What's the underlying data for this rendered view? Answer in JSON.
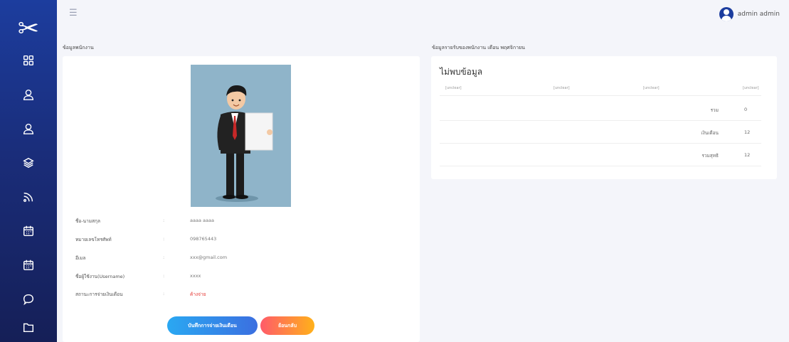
{
  "sidebar": {
    "logo_icon": "scissors-icon",
    "items": [
      {
        "icon": "grid-icon"
      },
      {
        "icon": "user-icon"
      },
      {
        "icon": "user-icon"
      },
      {
        "icon": "layers-icon"
      },
      {
        "icon": "rss-icon"
      },
      {
        "icon": "calendar-icon"
      },
      {
        "icon": "calendar-icon"
      },
      {
        "icon": "chat-icon"
      },
      {
        "icon": "folder-icon"
      }
    ]
  },
  "header": {
    "menu_icon": "hamburger-icon",
    "user_name": "admin admin"
  },
  "employee": {
    "section_title": "ข้อมูลพนักงาน",
    "rows": [
      {
        "label": "ชื่อ-นามสกุล",
        "value": "aaaa aaaa"
      },
      {
        "label": "หมายเลขโทรศัพท์",
        "value": "098765443"
      },
      {
        "label": "อีเมล",
        "value": "xxx@gmail.com"
      },
      {
        "label": "ชื่อผู้ใช้งาน(Username)",
        "value": "xxxx"
      },
      {
        "label": "สถานะการจ่ายเงินเดือน",
        "value": "ค้างจ่าย"
      }
    ],
    "colon": ":",
    "buttons": {
      "save": "บันทึกการจ่ายเงินเดือน",
      "back": "ย้อนกลับ"
    }
  },
  "income": {
    "section_title": "ข้อมูลรายรับของพนักงาน เดือน พฤศจิกายน",
    "empty_text": "ไม่พบข้อมูล",
    "columns": [
      "[unclear]",
      "[unclear]",
      "[unclear]",
      "[unclear]"
    ],
    "summary_rows": [
      {
        "label": "รวม",
        "value": "0"
      },
      {
        "label": "เงินเดือน",
        "value": "12"
      },
      {
        "label": "รวมสุทธิ",
        "value": "12"
      }
    ]
  },
  "colors": {
    "sidebar_top": "#1c3d9e",
    "sidebar_bottom": "#151f57",
    "status_red": "#e53935",
    "btn_primary": "#2aa8f2",
    "btn_back": "#ff5b6a"
  }
}
